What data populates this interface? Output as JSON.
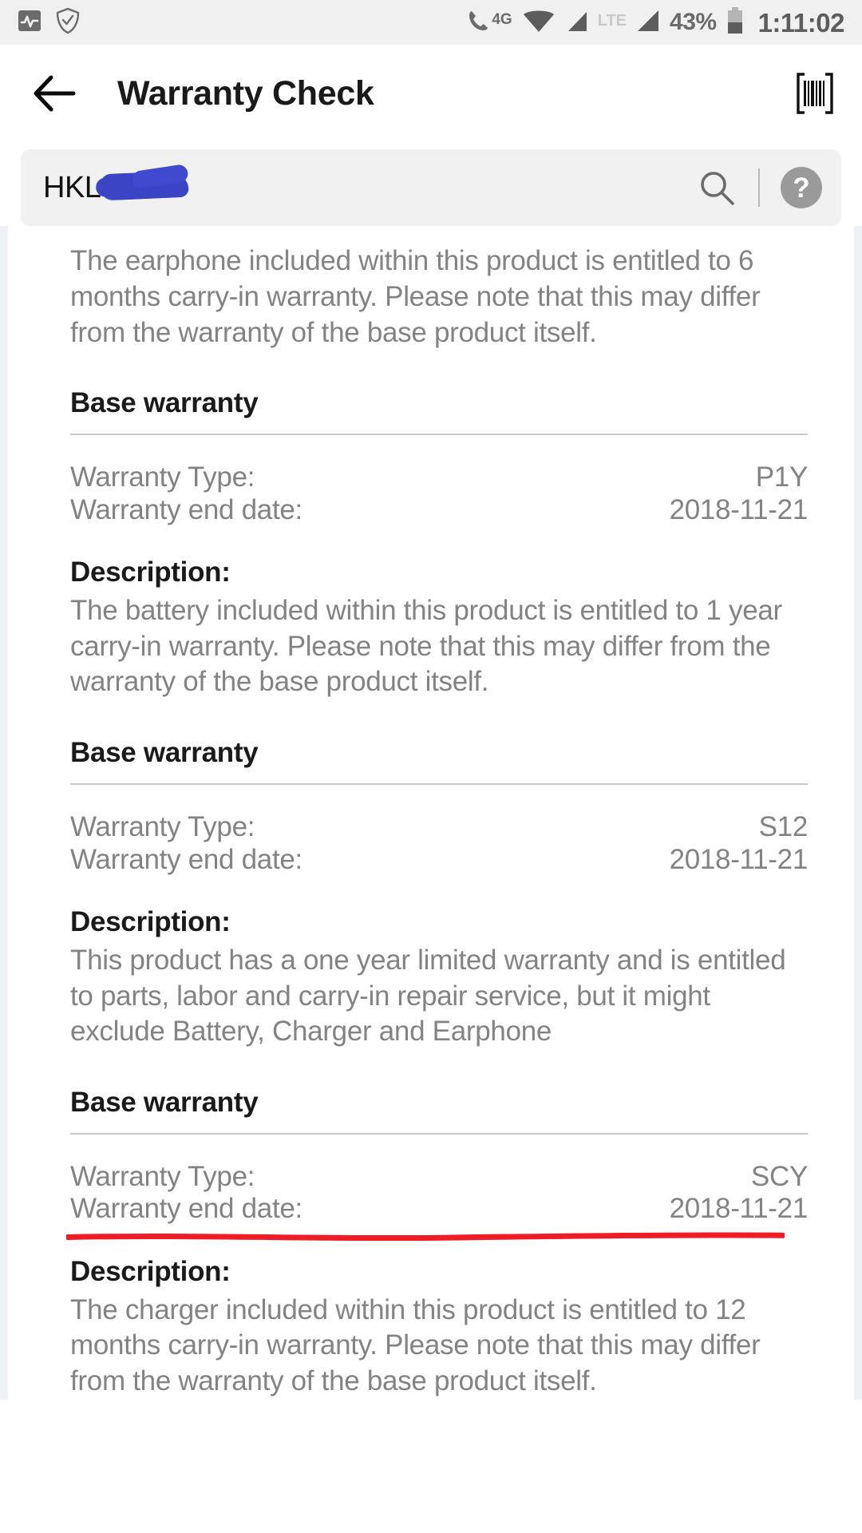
{
  "status_bar": {
    "left_icons": [
      "activity-monitor-icon",
      "shield-check-icon"
    ],
    "call_4g_label": "4G",
    "lte_label": "LTE",
    "battery_percent": "43%",
    "clock": "1:11:02"
  },
  "app_bar": {
    "back_icon": "back-arrow-icon",
    "title": "Warranty Check",
    "scan_icon": "barcode-scan-icon"
  },
  "search": {
    "value": "HKL",
    "redacted": true,
    "search_icon": "search-icon",
    "help_label": "?",
    "help_icon": "help-circle-icon"
  },
  "intro_paragraph": "The earphone included within this product is entitled to 6 months carry-in warranty.  Please note that this may differ from the warranty of the base product itself.",
  "labels": {
    "warranty_type": "Warranty Type:",
    "warranty_end_date": "Warranty end date:",
    "description": "Description:"
  },
  "annotation": {
    "red_underline_color": "#ee1c25",
    "target": "warranty-end-date-scy"
  },
  "sections": [
    {
      "title": "Base warranty",
      "warranty_type": "P1Y",
      "warranty_end_date": "2018-11-21",
      "description": "The battery included within this product is entitled to 1 year carry-in warranty.  Please note that this may differ from the warranty of the base product itself.",
      "highlighted": false
    },
    {
      "title": "Base warranty",
      "warranty_type": "S12",
      "warranty_end_date": "2018-11-21",
      "description": "This product has a one year limited warranty and is entitled to parts, labor and carry-in repair service, but it might exclude Battery, Charger and Earphone",
      "highlighted": false
    },
    {
      "title": "Base warranty",
      "warranty_type": "SCY",
      "warranty_end_date": "2018-11-21",
      "description": "The charger included within this product is entitled to 12 months carry-in warranty.  Please note that this may differ from the warranty of the base product itself.",
      "highlighted": true
    }
  ]
}
